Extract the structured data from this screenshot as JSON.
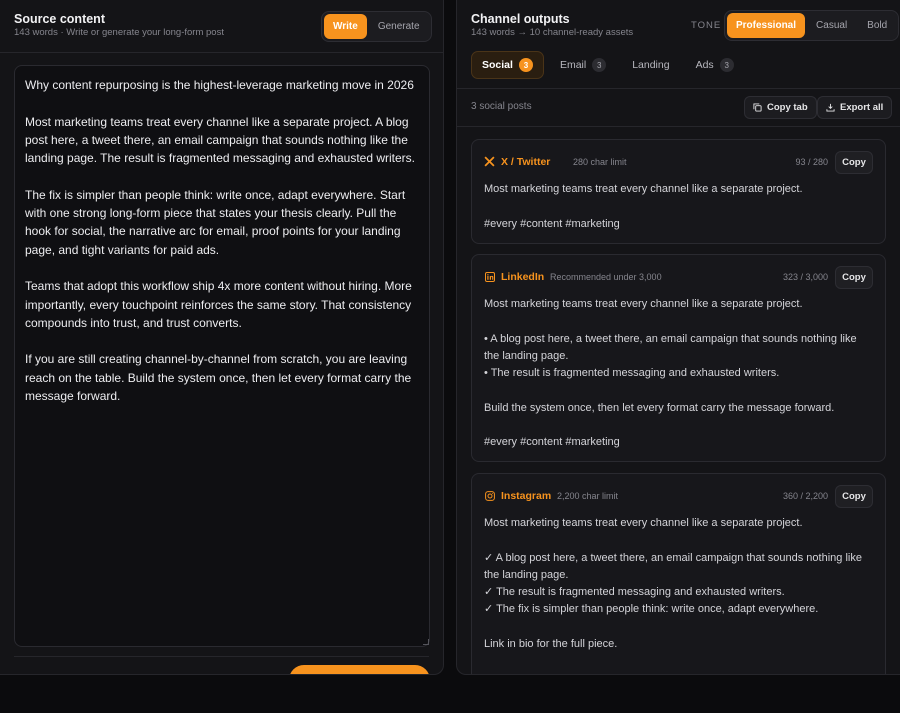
{
  "source": {
    "title": "Source content",
    "subtitle": "143 words · Write or generate your long-form post",
    "mode_tabs": [
      "Write",
      "Generate"
    ],
    "text": "Why content repurposing is the highest-leverage marketing move in 2026\n\nMost marketing teams treat every channel like a separate project. A blog post here, a tweet there, an email campaign that sounds nothing like the landing page. The result is fragmented messaging and exhausted writers.\n\nThe fix is simpler than people think: write once, adapt everywhere. Start with one strong long-form piece that states your thesis clearly. Pull the hook for social, the narrative arc for email, proof points for your landing page, and tight variants for paid ads.\n\nTeams that adopt this workflow ship 4x more content without hiring. More importantly, every touchpoint reinforces the same story. That consistency compounds into trust, and trust converts.\n\nIf you are still creating channel-by-channel from scratch, you are leaving reach on the table. Build the system once, then let every format carry the message forward."
  },
  "outputs": {
    "title": "Channel outputs",
    "subtitle": "143 words → 10 channel-ready assets",
    "tone_label": "TONE",
    "tones": [
      "Professional",
      "Casual",
      "Bold"
    ],
    "tabs": [
      {
        "label": "Social",
        "count": "3"
      },
      {
        "label": "Email",
        "count": "3"
      },
      {
        "label": "Landing",
        "count": ""
      },
      {
        "label": "Ads",
        "count": "3"
      }
    ],
    "toolbar": {
      "count_text": "3 social posts",
      "copy_tab": "Copy tab",
      "export_all": "Export all"
    },
    "cards": [
      {
        "icon": "x-logo-icon",
        "name": "X / Twitter",
        "limit": "280 char limit",
        "count": "93 / 280",
        "copy": "Copy",
        "body": "Most marketing teams treat every channel like a separate project.\n\n#every #content #marketing"
      },
      {
        "icon": "linkedin-icon",
        "name": "LinkedIn",
        "limit": "Recommended under 3,000",
        "count": "323 / 3,000",
        "copy": "Copy",
        "body": "Most marketing teams treat every channel like a separate project.\n\n• A blog post here, a tweet there, an email campaign that sounds nothing like the landing page.\n• The result is fragmented messaging and exhausted writers.\n\nBuild the system once, then let every format carry the message forward.\n\n#every #content #marketing"
      },
      {
        "icon": "instagram-icon",
        "name": "Instagram",
        "limit": "2,200 char limit",
        "count": "360 / 2,200",
        "copy": "Copy",
        "body": "Most marketing teams treat every channel like a separate project.\n\n✓ A blog post here, a tweet there, an email campaign that sounds nothing like the landing page.\n✓ The result is fragmented messaging and exhausted writers.\n✓ The fix is simpler than people think: write once, adapt everywhere.\n\nLink in bio for the full piece."
      }
    ]
  },
  "colors": {
    "accent": "#f7931e",
    "background": "#0b0b0d",
    "panel": "#141417"
  }
}
